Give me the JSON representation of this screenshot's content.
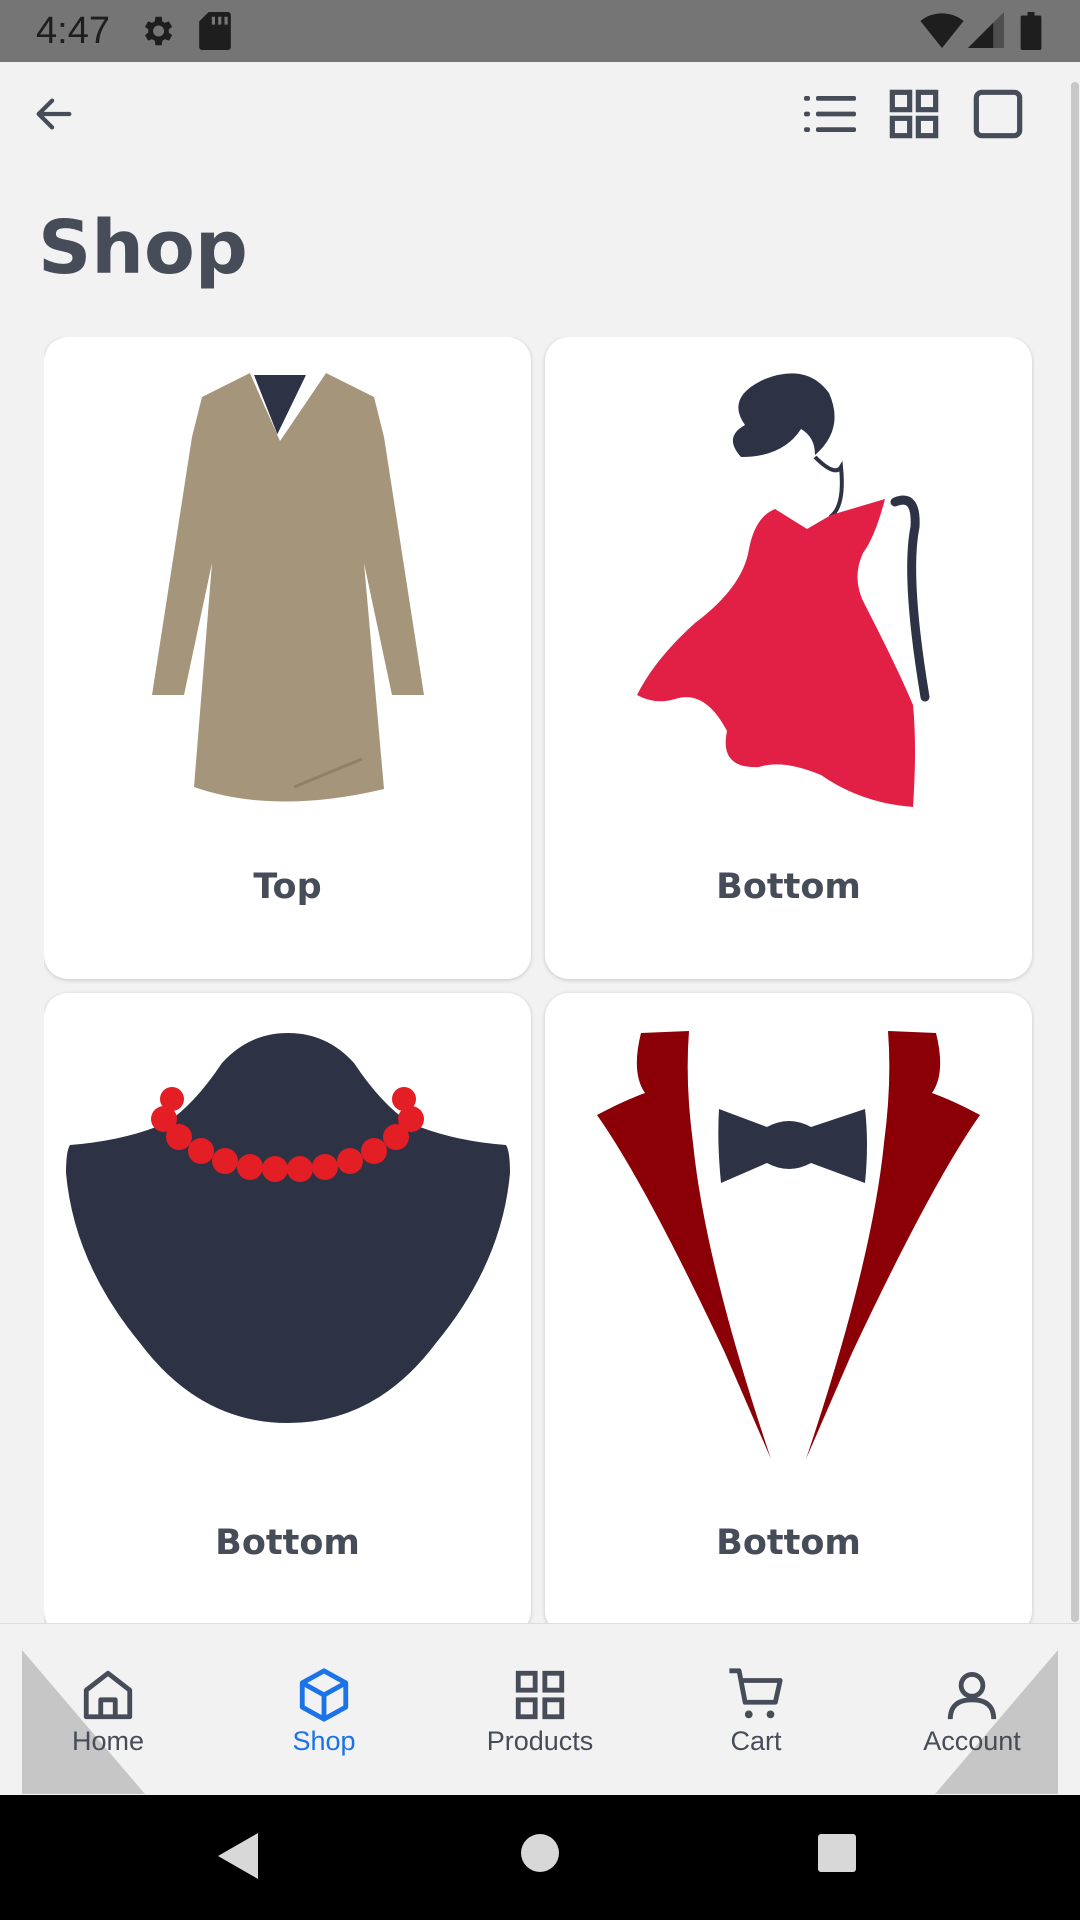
{
  "status_bar": {
    "time": "4:47"
  },
  "page": {
    "title": "Shop"
  },
  "cards": [
    {
      "label": "Top",
      "image": "coat"
    },
    {
      "label": "Bottom",
      "image": "red-dress"
    },
    {
      "label": "Bottom",
      "image": "necklace"
    },
    {
      "label": "Bottom",
      "image": "tuxedo"
    }
  ],
  "bottom_nav": {
    "items": [
      {
        "label": "Home",
        "icon": "home-icon",
        "active": false
      },
      {
        "label": "Shop",
        "icon": "box-icon",
        "active": true
      },
      {
        "label": "Products",
        "icon": "grid-icon",
        "active": false
      },
      {
        "label": "Cart",
        "icon": "cart-icon",
        "active": false
      },
      {
        "label": "Account",
        "icon": "user-icon",
        "active": false
      }
    ]
  },
  "colors": {
    "accent": "#1a73e8",
    "text": "#474c59",
    "background": "#f2f2f2"
  }
}
